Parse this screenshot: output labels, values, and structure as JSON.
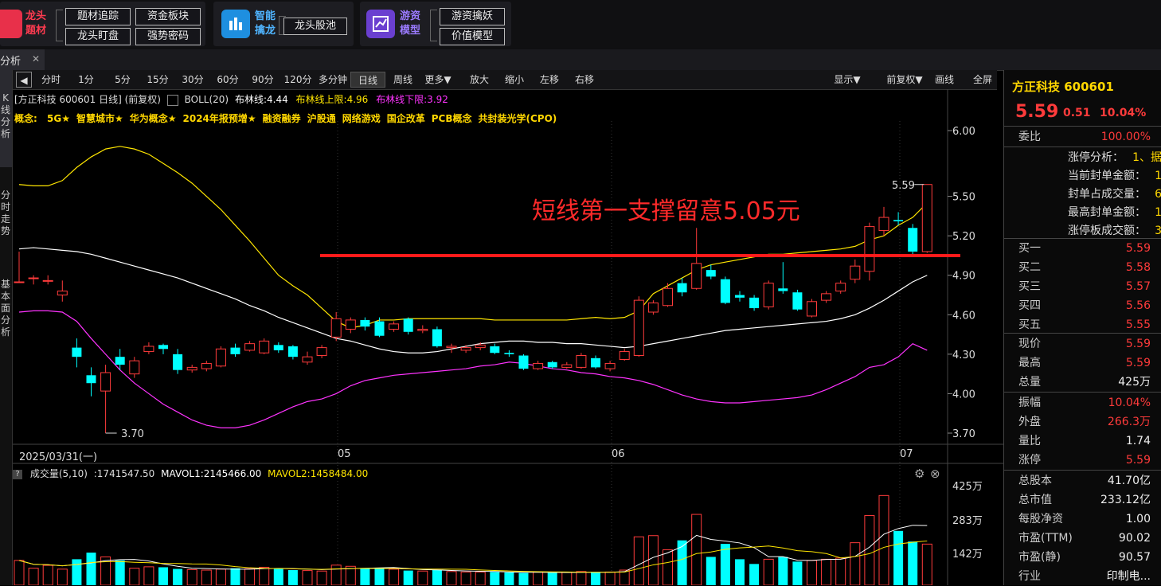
{
  "banner": {
    "group1": {
      "title1": "龙头",
      "title2": "题材",
      "buttons": [
        "题材追踪",
        "资金板块",
        "龙头盯盘",
        "强势密码"
      ]
    },
    "group2": {
      "title1": "智能",
      "title2": "擒龙",
      "buttons": [
        "龙头股池"
      ]
    },
    "group3": {
      "title1": "游资",
      "title2": "模型",
      "buttons": [
        "游资擒妖",
        "价值模型"
      ]
    },
    "colors": {
      "red": "#e8304a",
      "blue": "#1e8fe0",
      "purple": "#6a3fd0"
    }
  },
  "tab": {
    "label": "分析",
    "close": "✕"
  },
  "toolbar": {
    "items": [
      "分时",
      "1分",
      "5分",
      "15分",
      "30分",
      "60分",
      "90分",
      "120分",
      "多分钟",
      "日线",
      "周线",
      "更多▼",
      "放大",
      "缩小",
      "左移",
      "右移",
      "显示▼",
      "前复权▼",
      "画线",
      "全屏"
    ],
    "active": "日线"
  },
  "leftstrip": {
    "labels": [
      "K线分析",
      "分时走势",
      "基本面分析"
    ]
  },
  "chart": {
    "header": "[方正科技 600601 日线] (前复权)",
    "boll_label": "BOLL(20)",
    "boll_mid": "布林线:4.44",
    "boll_up": "布林线上限:4.96",
    "boll_low": "布林线下限:3.92",
    "concepts_label": "概念:",
    "concepts": [
      "5G★",
      "智慧城市★",
      "华为概念★",
      "2024年报预增★",
      "融资融券",
      "沪股通",
      "网络游戏",
      "国企改革",
      "PCB概念",
      "共封装光学(CPO)"
    ],
    "annotation": "短线第一支撑留意5.05元",
    "max_label": "5.59",
    "min_label": "3.70",
    "date_label": "2025/03/31(一)",
    "month_labels": [
      "05",
      "06",
      "07"
    ],
    "ylabels": [
      "6.00",
      "5.50",
      "5.20",
      "4.90",
      "4.60",
      "4.30",
      "4.00",
      "3.70"
    ],
    "support": 5.05
  },
  "chart_data": {
    "type": "candlestick",
    "ylim": [
      3.7,
      6.0
    ],
    "candles": [
      [
        4.85,
        4.85,
        5.08,
        4.85
      ],
      [
        4.88,
        4.88,
        4.9,
        4.83
      ],
      [
        4.86,
        4.86,
        4.9,
        4.83
      ],
      [
        4.75,
        4.78,
        4.86,
        4.7
      ],
      [
        4.35,
        4.28,
        4.42,
        4.2
      ],
      [
        4.14,
        4.08,
        4.2,
        3.98
      ],
      [
        4.02,
        4.16,
        4.22,
        3.7
      ],
      [
        4.28,
        4.22,
        4.34,
        4.18
      ],
      [
        4.15,
        4.25,
        4.28,
        4.12
      ],
      [
        4.32,
        4.36,
        4.39,
        4.3
      ],
      [
        4.37,
        4.34,
        4.38,
        4.3
      ],
      [
        4.3,
        4.18,
        4.34,
        4.15
      ],
      [
        4.18,
        4.2,
        4.22,
        4.16
      ],
      [
        4.19,
        4.23,
        4.25,
        4.17
      ],
      [
        4.21,
        4.34,
        4.36,
        4.2
      ],
      [
        4.35,
        4.3,
        4.38,
        4.28
      ],
      [
        4.33,
        4.38,
        4.4,
        4.32
      ],
      [
        4.31,
        4.4,
        4.42,
        4.3
      ],
      [
        4.37,
        4.33,
        4.39,
        4.31
      ],
      [
        4.36,
        4.28,
        4.37,
        4.26
      ],
      [
        4.24,
        4.28,
        4.32,
        4.22
      ],
      [
        4.29,
        4.35,
        4.37,
        4.27
      ],
      [
        4.43,
        4.57,
        4.62,
        4.4
      ],
      [
        4.49,
        4.56,
        4.58,
        4.46
      ],
      [
        4.56,
        4.51,
        4.58,
        4.48
      ],
      [
        4.55,
        4.44,
        4.58,
        4.43
      ],
      [
        4.49,
        4.53,
        4.55,
        4.47
      ],
      [
        4.57,
        4.47,
        4.58,
        4.45
      ],
      [
        4.48,
        4.49,
        4.52,
        4.46
      ],
      [
        4.49,
        4.36,
        4.51,
        4.35
      ],
      [
        4.35,
        4.36,
        4.38,
        4.31
      ],
      [
        4.33,
        4.35,
        4.37,
        4.31
      ],
      [
        4.35,
        4.37,
        4.39,
        4.33
      ],
      [
        4.36,
        4.31,
        4.38,
        4.3
      ],
      [
        4.31,
        4.3,
        4.33,
        4.28
      ],
      [
        4.29,
        4.19,
        4.3,
        4.18
      ],
      [
        4.19,
        4.23,
        4.25,
        4.18
      ],
      [
        4.24,
        4.2,
        4.25,
        4.19
      ],
      [
        4.2,
        4.22,
        4.24,
        4.19
      ],
      [
        4.2,
        4.29,
        4.31,
        4.19
      ],
      [
        4.27,
        4.2,
        4.29,
        4.19
      ],
      [
        4.19,
        4.23,
        4.25,
        4.17
      ],
      [
        4.26,
        4.32,
        4.34,
        4.25
      ],
      [
        4.29,
        4.71,
        4.74,
        4.28
      ],
      [
        4.62,
        4.69,
        4.71,
        4.6
      ],
      [
        4.67,
        4.8,
        4.84,
        4.66
      ],
      [
        4.84,
        4.77,
        4.88,
        4.74
      ],
      [
        4.8,
        4.99,
        5.26,
        4.79
      ],
      [
        4.94,
        4.89,
        4.98,
        4.87
      ],
      [
        4.87,
        4.69,
        4.89,
        4.68
      ],
      [
        4.75,
        4.73,
        4.78,
        4.7
      ],
      [
        4.73,
        4.65,
        4.75,
        4.63
      ],
      [
        4.66,
        4.84,
        4.86,
        4.64
      ],
      [
        4.8,
        4.78,
        5.0,
        4.76
      ],
      [
        4.77,
        4.64,
        4.79,
        4.63
      ],
      [
        4.59,
        4.7,
        4.72,
        4.58
      ],
      [
        4.71,
        4.76,
        4.78,
        4.69
      ],
      [
        4.78,
        4.84,
        4.86,
        4.76
      ],
      [
        4.87,
        4.97,
        5.02,
        4.84
      ],
      [
        4.93,
        5.27,
        5.3,
        4.86
      ],
      [
        5.24,
        5.34,
        5.42,
        5.2
      ],
      [
        5.32,
        5.31,
        5.38,
        5.28
      ],
      [
        5.26,
        5.08,
        5.29,
        5.06
      ],
      [
        5.08,
        5.59,
        5.59,
        5.07
      ]
    ],
    "boll_mid": [
      5.1,
      5.11,
      5.1,
      5.09,
      5.08,
      5.06,
      5.03,
      5.0,
      4.97,
      4.94,
      4.91,
      4.88,
      4.84,
      4.8,
      4.76,
      4.72,
      4.67,
      4.63,
      4.58,
      4.54,
      4.5,
      4.46,
      4.42,
      4.4,
      4.37,
      4.34,
      4.32,
      4.31,
      4.31,
      4.32,
      4.34,
      4.36,
      4.38,
      4.39,
      4.4,
      4.4,
      4.39,
      4.39,
      4.38,
      4.38,
      4.37,
      4.36,
      4.35,
      4.36,
      4.38,
      4.4,
      4.42,
      4.44,
      4.46,
      4.48,
      4.49,
      4.5,
      4.51,
      4.52,
      4.53,
      4.54,
      4.55,
      4.57,
      4.6,
      4.65,
      4.71,
      4.78,
      4.85,
      4.9
    ],
    "boll_up": [
      5.59,
      5.58,
      5.58,
      5.62,
      5.72,
      5.8,
      5.86,
      5.88,
      5.86,
      5.82,
      5.75,
      5.68,
      5.6,
      5.5,
      5.4,
      5.28,
      5.16,
      5.03,
      4.9,
      4.82,
      4.75,
      4.65,
      4.55,
      4.5,
      4.52,
      4.56,
      4.56,
      4.57,
      4.57,
      4.57,
      4.57,
      4.57,
      4.57,
      4.56,
      4.56,
      4.56,
      4.56,
      4.56,
      4.56,
      4.57,
      4.58,
      4.57,
      4.58,
      4.63,
      4.76,
      4.82,
      4.88,
      4.94,
      4.98,
      5.0,
      5.02,
      5.04,
      5.06,
      5.06,
      5.07,
      5.08,
      5.09,
      5.1,
      5.12,
      5.17,
      5.2,
      5.28,
      5.34,
      5.45
    ],
    "boll_low": [
      4.62,
      4.63,
      4.63,
      4.62,
      4.55,
      4.42,
      4.3,
      4.18,
      4.08,
      4.0,
      3.92,
      3.86,
      3.8,
      3.76,
      3.74,
      3.74,
      3.76,
      3.8,
      3.85,
      3.9,
      3.94,
      3.96,
      4.0,
      4.06,
      4.1,
      4.12,
      4.14,
      4.15,
      4.16,
      4.17,
      4.18,
      4.19,
      4.21,
      4.22,
      4.24,
      4.23,
      4.21,
      4.19,
      4.18,
      4.16,
      4.15,
      4.13,
      4.12,
      4.1,
      4.07,
      4.03,
      3.99,
      3.96,
      3.94,
      3.93,
      3.93,
      3.94,
      3.95,
      3.96,
      3.97,
      3.99,
      4.03,
      4.08,
      4.13,
      4.2,
      4.22,
      4.28,
      4.38,
      4.33
    ],
    "volume_ylim": [
      0,
      4250000
    ],
    "volumes": [
      1050000,
      720000,
      840000,
      680000,
      1100000,
      1380000,
      1200000,
      1050000,
      720000,
      780000,
      760000,
      690000,
      660000,
      640000,
      680000,
      720000,
      700000,
      760000,
      700000,
      640000,
      620000,
      600000,
      850000,
      800000,
      720000,
      700000,
      680000,
      620000,
      600000,
      650000,
      580000,
      560000,
      560000,
      560000,
      540000,
      520000,
      560000,
      530000,
      540000,
      580000,
      540000,
      560000,
      640000,
      2050000,
      2100000,
      1500000,
      1900000,
      3000000,
      1200000,
      1750000,
      1100000,
      900000,
      1100000,
      1200000,
      1000000,
      1050000,
      1100000,
      1150000,
      1800000,
      2950000,
      3800000,
      2300000,
      1850000,
      1741547
    ]
  },
  "volume_panel": {
    "title": "成交量(5,10)",
    "vol": ":1741547.50",
    "mavol1": "MAVOL1:2145466.00",
    "mavol2": "MAVOL2:1458484.00",
    "ylabels": [
      "425万",
      "283万",
      "142万"
    ]
  },
  "quote": {
    "name": "方正科技 600601",
    "price": "5.59",
    "change": "0.51",
    "pct": "10.04%",
    "weibi_k": "委比",
    "weibi_v": "100.00%",
    "limit_info": [
      [
        "涨停分析：",
        "1、据"
      ],
      [
        "当前封单金额：",
        "1"
      ],
      [
        "封单占成交量：",
        "6"
      ],
      [
        "最高封单金额：",
        "1"
      ],
      [
        "涨停板成交额：",
        "3"
      ]
    ],
    "bids": [
      [
        "买一",
        "5.59"
      ],
      [
        "买二",
        "5.58"
      ],
      [
        "买三",
        "5.57"
      ],
      [
        "买四",
        "5.56"
      ],
      [
        "买五",
        "5.55"
      ]
    ],
    "stats": [
      [
        "现价",
        "5.59",
        "red"
      ],
      [
        "最高",
        "5.59",
        "red"
      ],
      [
        "总量",
        "425万",
        "white"
      ],
      [
        "振幅",
        "10.04%",
        "red"
      ],
      [
        "外盘",
        "266.3万",
        "red"
      ],
      [
        "量比",
        "1.74",
        "white"
      ],
      [
        "涨停",
        "5.59",
        "red"
      ],
      [
        "总股本",
        "41.70亿",
        "white"
      ],
      [
        "总市值",
        "233.12亿",
        "white"
      ],
      [
        "每股净资",
        "1.00",
        "white"
      ],
      [
        "市盈(TTM)",
        "90.02",
        "white"
      ],
      [
        "市盈(静)",
        "90.57",
        "white"
      ],
      [
        "行业",
        "印制电...",
        "white"
      ]
    ]
  }
}
